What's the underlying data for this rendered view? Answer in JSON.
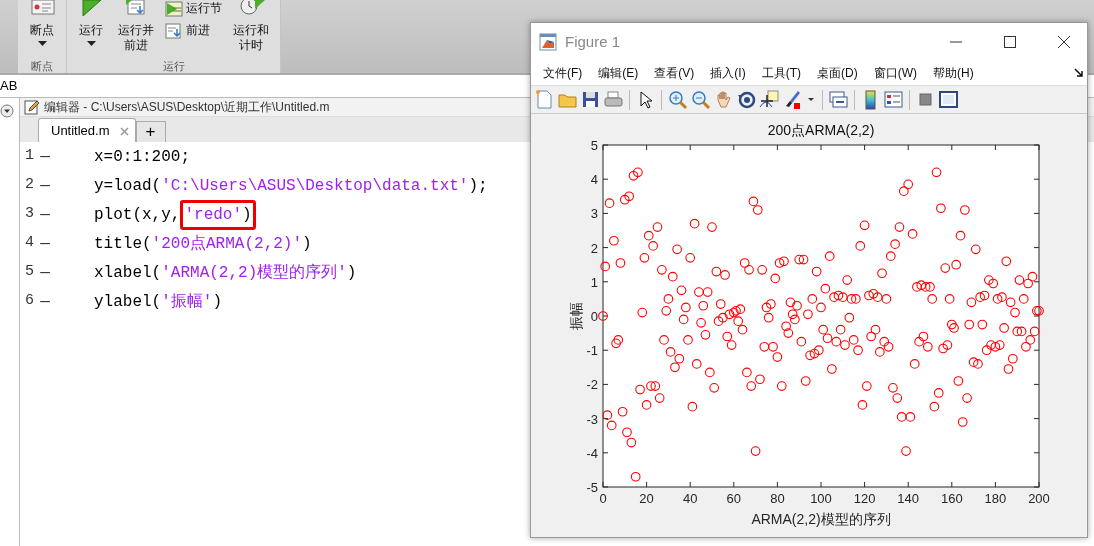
{
  "toolstrip": {
    "sections": [
      {
        "label": "断点",
        "items": [
          {
            "kind": "large",
            "label": "断点",
            "dropdown": true
          }
        ]
      },
      {
        "label": "运行",
        "items": [
          {
            "kind": "large",
            "label": "运行",
            "dropdown": true
          },
          {
            "kind": "large",
            "label": "运行并前进",
            "dropdown": false
          },
          {
            "kind": "stack",
            "entries": [
              "运行节",
              "前进"
            ]
          },
          {
            "kind": "large",
            "label": "运行和计时",
            "dropdown": false
          }
        ]
      }
    ]
  },
  "address_bar": {
    "text": "AB"
  },
  "editor": {
    "title": "编辑器 - C:\\Users\\ASUS\\Desktop\\近期工作\\Untitled.m",
    "tabs": [
      {
        "label": "Untitled.m",
        "selected": true
      }
    ],
    "new_tab": "+",
    "lines": [
      {
        "number": "1",
        "marker": "—",
        "segments": [
          {
            "kind": "plain",
            "text": "x=0:1:200;"
          }
        ]
      },
      {
        "number": "2",
        "marker": "—",
        "segments": [
          {
            "kind": "plain",
            "text": "y=load("
          },
          {
            "kind": "string",
            "text": "'C:\\Users\\ASUS\\Desktop\\data.txt'"
          },
          {
            "kind": "plain",
            "text": ");"
          }
        ]
      },
      {
        "number": "3",
        "marker": "—",
        "segments": [
          {
            "kind": "plain",
            "text": "plot(x,y,"
          },
          {
            "kind": "boxed",
            "segments": [
              {
                "kind": "string",
                "text": "'redo'"
              },
              {
                "kind": "plain",
                "text": ")"
              }
            ]
          }
        ]
      },
      {
        "number": "4",
        "marker": "—",
        "segments": [
          {
            "kind": "plain",
            "text": "title("
          },
          {
            "kind": "string",
            "text": "'200点ARMA(2,2)'"
          },
          {
            "kind": "plain",
            "text": ")"
          }
        ]
      },
      {
        "number": "5",
        "marker": "—",
        "segments": [
          {
            "kind": "plain",
            "text": "xlabel("
          },
          {
            "kind": "string",
            "text": "'ARMA(2,2)模型的序列'"
          },
          {
            "kind": "plain",
            "text": ")"
          }
        ]
      },
      {
        "number": "6",
        "marker": "—",
        "segments": [
          {
            "kind": "plain",
            "text": "ylabel("
          },
          {
            "kind": "string",
            "text": "'振幅'"
          },
          {
            "kind": "plain",
            "text": ")"
          }
        ]
      }
    ]
  },
  "figure": {
    "title": "Figure 1",
    "menus": [
      "文件(F)",
      "编辑(E)",
      "查看(V)",
      "插入(I)",
      "工具(T)",
      "桌面(D)",
      "窗口(W)",
      "帮助(H)"
    ],
    "chart_data": {
      "type": "scatter",
      "title": "200点ARMA(2,2)",
      "xlabel": "ARMA(2,2)模型的序列",
      "ylabel": "振幅",
      "xlim": [
        0,
        200
      ],
      "ylim": [
        -5,
        5
      ],
      "xticks": [
        0,
        20,
        40,
        60,
        80,
        100,
        120,
        140,
        160,
        180,
        200
      ],
      "yticks": [
        -5,
        -4,
        -3,
        -2,
        -1,
        0,
        1,
        2,
        3,
        4,
        5
      ],
      "x": [
        0,
        1,
        2,
        3,
        4,
        5,
        6,
        7,
        8,
        9,
        10,
        11,
        12,
        13,
        14,
        15,
        16,
        17,
        18,
        19,
        20,
        21,
        22,
        23,
        24,
        25,
        26,
        27,
        28,
        29,
        30,
        31,
        32,
        33,
        34,
        35,
        36,
        37,
        38,
        39,
        40,
        41,
        42,
        43,
        44,
        45,
        46,
        47,
        48,
        49,
        50,
        51,
        52,
        53,
        54,
        55,
        56,
        57,
        58,
        59,
        60,
        61,
        62,
        63,
        64,
        65,
        66,
        67,
        68,
        69,
        70,
        71,
        72,
        73,
        74,
        75,
        76,
        77,
        78,
        79,
        80,
        81,
        82,
        83,
        84,
        85,
        86,
        87,
        88,
        89,
        90,
        91,
        92,
        93,
        94,
        95,
        96,
        97,
        98,
        99,
        100,
        101,
        102,
        103,
        104,
        105,
        106,
        107,
        108,
        109,
        110,
        111,
        112,
        113,
        114,
        115,
        116,
        117,
        118,
        119,
        120,
        121,
        122,
        123,
        124,
        125,
        126,
        127,
        128,
        129,
        130,
        131,
        132,
        133,
        134,
        135,
        136,
        137,
        138,
        139,
        140,
        141,
        142,
        143,
        144,
        145,
        146,
        147,
        148,
        149,
        150,
        151,
        152,
        153,
        154,
        155,
        156,
        157,
        158,
        159,
        160,
        161,
        162,
        163,
        164,
        165,
        166,
        167,
        168,
        169,
        170,
        171,
        172,
        173,
        174,
        175,
        176,
        177,
        178,
        179,
        180,
        181,
        182,
        183,
        184,
        185,
        186,
        187,
        188,
        189,
        190,
        191,
        192,
        193,
        194,
        195,
        196,
        197,
        198,
        199,
        200
      ],
      "series": [
        {
          "color": "#ff0000",
          "values": [
            0,
            1.45,
            -2.9,
            3.3,
            -3.2,
            2.2,
            -0.8,
            -0.7,
            1.55,
            -2.8,
            3.4,
            -3.4,
            3.5,
            -3.7,
            4.1,
            -4.7,
            4.2,
            -2.15,
            0.1,
            1.7,
            -2.6,
            2.35,
            -2.05,
            2.05,
            -2.05,
            2.6,
            -2.4,
            1.35,
            -0.7,
            0.15,
            0.5,
            -1.05,
            1.15,
            -1.5,
            1.95,
            -1.25,
            0.75,
            -0.1,
            0.25,
            -0.7,
            1.7,
            -2.65,
            2.7,
            -1.4,
            0.7,
            -0.2,
            0.3,
            -0.55,
            0.7,
            -1.65,
            2.6,
            -2.1,
            1.3,
            -0.15,
            0.35,
            -0.05,
            1.2,
            -0.6,
            0.05,
            -0.85,
            0.1,
            0.15,
            -0.15,
            0.2,
            -0.4,
            1.55,
            -1.65,
            1.35,
            -2.05,
            3.35,
            -3.95,
            3.1,
            -1.85,
            1.35,
            -0.9,
            0.25,
            -0.05,
            0.35,
            -0.9,
            1.1,
            -1.2,
            1.55,
            -2.05,
            1.6,
            -0.3,
            -0.5,
            0.4,
            0.05,
            -0.1,
            0.3,
            1.65,
            -0.75,
            1.65,
            -1.9,
            0.05,
            -1.15,
            0.5,
            -1.1,
            1.3,
            -1,
            0.25,
            -0.4,
            0.8,
            -0.65,
            1.75,
            -1.55,
            0.55,
            -0.75,
            0.6,
            -0.4,
            0.55,
            -0.85,
            1.05,
            -0.05,
            0.5,
            -0.7,
            0.5,
            -1,
            2.05,
            -2.6,
            2.65,
            -2.05,
            0.6,
            -0.6,
            0.65,
            -0.4,
            0.55,
            -1.05,
            1.25,
            -0.75,
            0.5,
            -0.9,
            1.75,
            -2.1,
            2.1,
            -2.4,
            2.6,
            -2.95,
            3.65,
            -3.95,
            3.85,
            -2.95,
            2.4,
            -1.4,
            0.85,
            -0.75,
            0.9,
            -0.6,
            0.85,
            -0.9,
            0.85,
            0.5,
            -2.65,
            4.2,
            -2.25,
            3.15,
            -0.95,
            1.4,
            -0.85,
            0.5,
            -0.25,
            -0.35,
            1.5,
            -1.9,
            2.35,
            -3.1,
            3.1,
            -2.4,
            -0.25,
            0.4,
            -1.35,
            1.95,
            -1.4,
            0.55,
            -0.25,
            0.6,
            -1,
            1.05,
            -0.85,
            0.95,
            -0.9,
            0.5,
            -0.85,
            0.55,
            -0.35,
            1.6,
            -1.55,
            0.4,
            -1.25,
            0.1,
            -0.45,
            1.05,
            -0.45,
            0.5,
            -0.9,
            0.95,
            -0.7,
            1.15,
            -0.45,
            0.15,
            0.15
          ]
        }
      ]
    }
  }
}
